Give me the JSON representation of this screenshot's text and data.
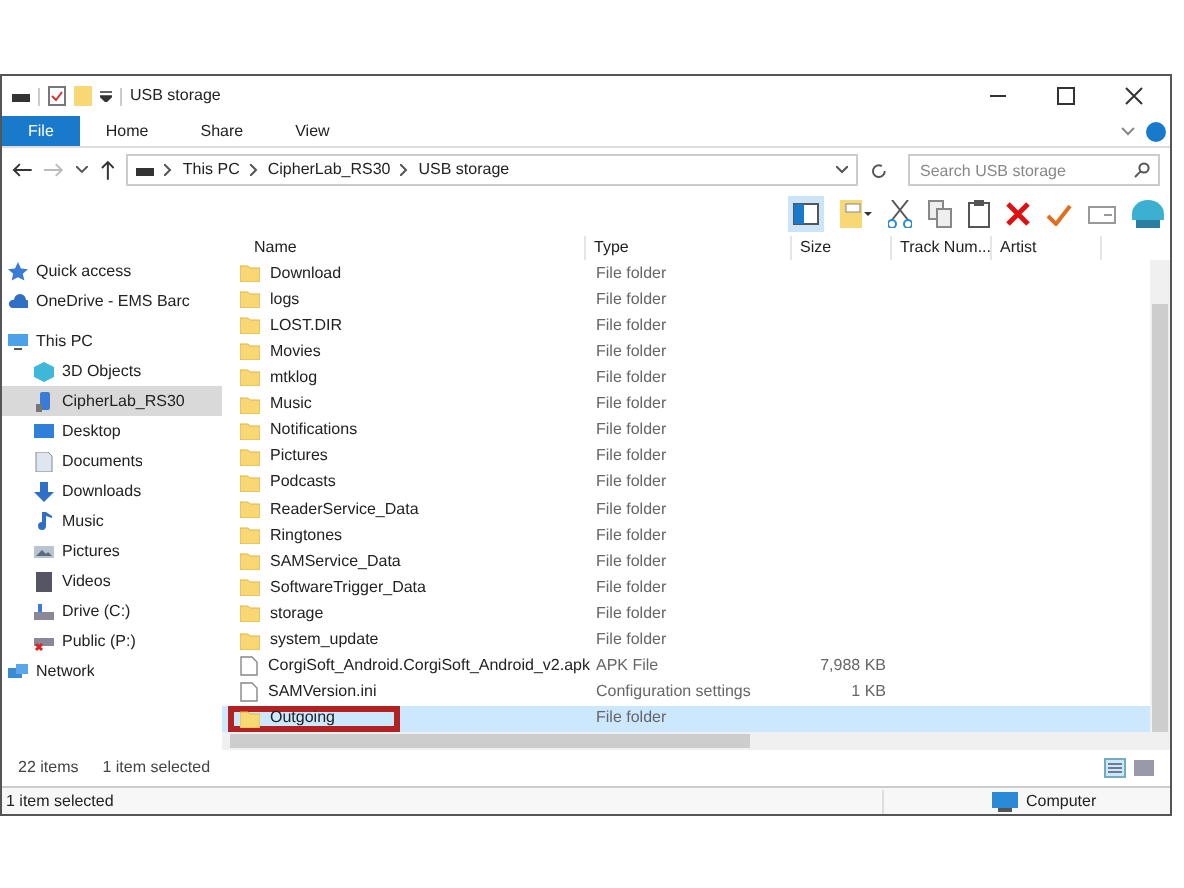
{
  "window": {
    "title": "USB storage"
  },
  "ribbon_tabs": [
    {
      "label": "File",
      "selected": true
    },
    {
      "label": "Home",
      "selected": false
    },
    {
      "label": "Share",
      "selected": false
    },
    {
      "label": "View",
      "selected": false
    }
  ],
  "address": {
    "path": [
      "This PC",
      "CipherLab_RS30",
      "USB storage"
    ],
    "search_placeholder": "Search USB storage"
  },
  "sidebar": [
    {
      "label": "Quick access",
      "selected": false
    },
    {
      "label": "OneDrive - EMS Barc",
      "selected": false
    },
    {
      "label": "This PC",
      "selected": false,
      "children": [
        {
          "label": "3D Objects",
          "selected": false
        },
        {
          "label": "CipherLab_RS30",
          "selected": true
        },
        {
          "label": "Desktop",
          "selected": false
        },
        {
          "label": "Documents",
          "selected": false
        },
        {
          "label": "Downloads",
          "selected": false
        },
        {
          "label": "Music",
          "selected": false
        },
        {
          "label": "Pictures",
          "selected": false
        },
        {
          "label": "Videos",
          "selected": false
        },
        {
          "label": "Drive (C:)",
          "selected": false
        },
        {
          "label": "Public (P:)",
          "selected": false
        }
      ]
    },
    {
      "label": "Network",
      "selected": false
    }
  ],
  "columns": [
    "Name",
    "Type",
    "Size",
    "Track Num...",
    "Artist"
  ],
  "rows": [
    {
      "name": "Download",
      "kind": "folder",
      "type": "File folder",
      "selected": false,
      "outlined": false
    },
    {
      "name": "logs",
      "kind": "folder",
      "type": "File folder",
      "selected": false,
      "outlined": false
    },
    {
      "name": "LOST.DIR",
      "kind": "folder",
      "type": "File folder",
      "selected": false,
      "outlined": false
    },
    {
      "name": "Movies",
      "kind": "folder",
      "type": "File folder",
      "selected": false,
      "outlined": false
    },
    {
      "name": "mtklog",
      "kind": "folder",
      "type": "File folder",
      "selected": false,
      "outlined": false
    },
    {
      "name": "Music",
      "kind": "folder",
      "type": "File folder",
      "selected": false,
      "outlined": false
    },
    {
      "name": "Notifications",
      "kind": "folder",
      "type": "File folder",
      "selected": false,
      "outlined": false
    },
    {
      "name": "Pictures",
      "kind": "folder",
      "type": "File folder",
      "selected": false,
      "outlined": false
    },
    {
      "name": "Podcasts",
      "kind": "folder",
      "type": "File folder",
      "selected": false,
      "outlined": false
    },
    {
      "name": "ReaderService_Data",
      "kind": "folder",
      "type": "File folder",
      "selected": false,
      "outlined": false
    },
    {
      "name": "Ringtones",
      "kind": "folder",
      "type": "File folder",
      "selected": false,
      "outlined": false
    },
    {
      "name": "SAMService_Data",
      "kind": "folder",
      "type": "File folder",
      "selected": false,
      "outlined": false
    },
    {
      "name": "SoftwareTrigger_Data",
      "kind": "folder",
      "type": "File folder",
      "selected": false,
      "outlined": false
    },
    {
      "name": "storage",
      "kind": "folder",
      "type": "File folder",
      "selected": false,
      "outlined": false
    },
    {
      "name": "system_update",
      "kind": "folder",
      "type": "File folder",
      "selected": false,
      "outlined": false
    },
    {
      "name": "CorgiSoft_Android.CorgiSoft_Android_v2.apk",
      "kind": "file",
      "type": "APK File",
      "size": "7,988 KB",
      "selected": false,
      "outlined": false
    },
    {
      "name": "SAMVersion.ini",
      "kind": "file",
      "type": "Configuration settings",
      "size": "1 KB",
      "selected": false,
      "outlined": false
    },
    {
      "name": "Outgoing",
      "kind": "folder",
      "type": "File folder",
      "selected": true,
      "outlined": true
    }
  ],
  "item_count": "22 items",
  "selection_count": "1 item selected",
  "status_bar": {
    "text": "1 item selected",
    "zone": "Computer"
  }
}
